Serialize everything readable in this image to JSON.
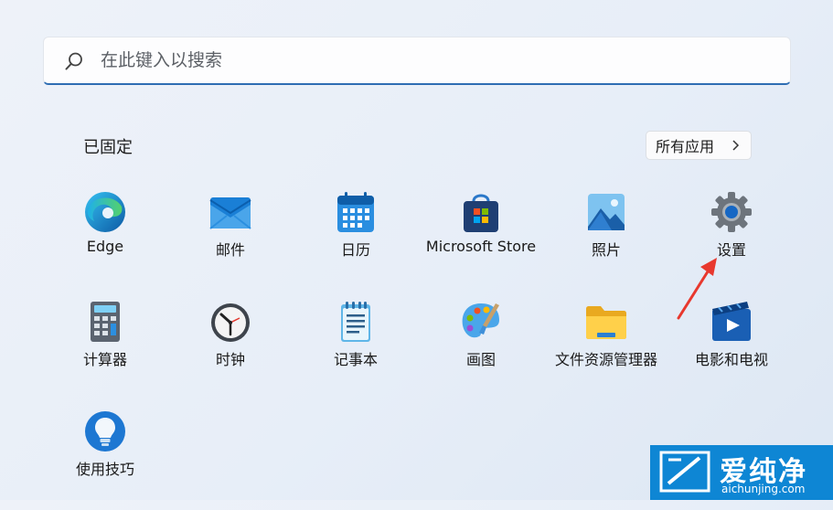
{
  "search": {
    "placeholder": "在此键入以搜索"
  },
  "pinned": {
    "title": "已固定",
    "all_apps_label": "所有应用"
  },
  "apps": [
    {
      "name": "Edge"
    },
    {
      "name": "邮件"
    },
    {
      "name": "日历"
    },
    {
      "name": "Microsoft Store"
    },
    {
      "name": "照片"
    },
    {
      "name": "设置"
    },
    {
      "name": "计算器"
    },
    {
      "name": "时钟"
    },
    {
      "name": "记事本"
    },
    {
      "name": "画图"
    },
    {
      "name": "文件资源管理器"
    },
    {
      "name": "电影和电视"
    },
    {
      "name": "使用技巧"
    }
  ],
  "watermark": {
    "name": "爱纯净",
    "url": "aichunjing.com"
  },
  "colors": {
    "accent": "#2e6db3",
    "annotation_arrow": "#e8382e",
    "watermark_bg": "#0e86d4"
  }
}
